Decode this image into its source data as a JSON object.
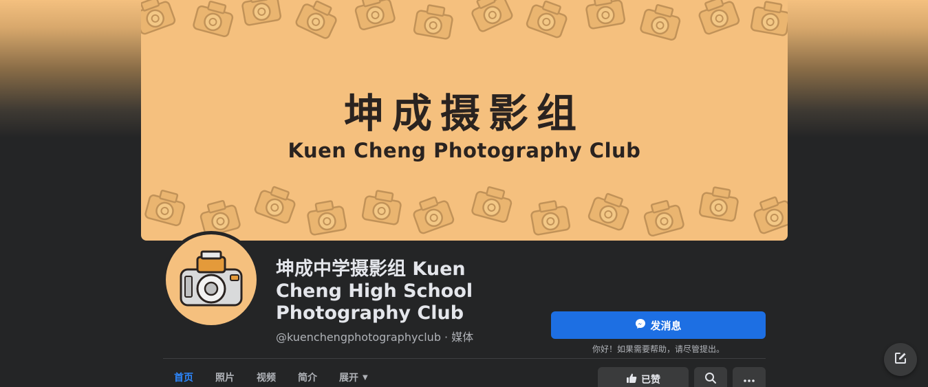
{
  "cover": {
    "title_zh": "坤成摄影组",
    "title_en": "Kuen Cheng Photography Club"
  },
  "page": {
    "name": "坤成中学摄影组 Kuen Cheng High School Photography Club",
    "handle": "@kuenchengphotographyclub · 媒体"
  },
  "actions": {
    "message_label": "发消息",
    "message_hint": "你好！如果需要帮助，请尽管提出。",
    "like_label": "已赞"
  },
  "tabs": [
    {
      "label": "首页",
      "active": true
    },
    {
      "label": "照片",
      "active": false
    },
    {
      "label": "视频",
      "active": false
    },
    {
      "label": "简介",
      "active": false
    },
    {
      "label": "展开",
      "active": false
    }
  ],
  "colors": {
    "accent": "#1d6fe3",
    "active_tab": "#2d88ff",
    "cover_bg": "#f5c07e",
    "page_bg": "#242526"
  },
  "icons": {
    "message": "messenger-icon",
    "like": "thumbs-up-icon",
    "search": "search-icon",
    "more": "more-icon",
    "compose": "compose-icon",
    "tab_more": "chevron-down-icon"
  }
}
